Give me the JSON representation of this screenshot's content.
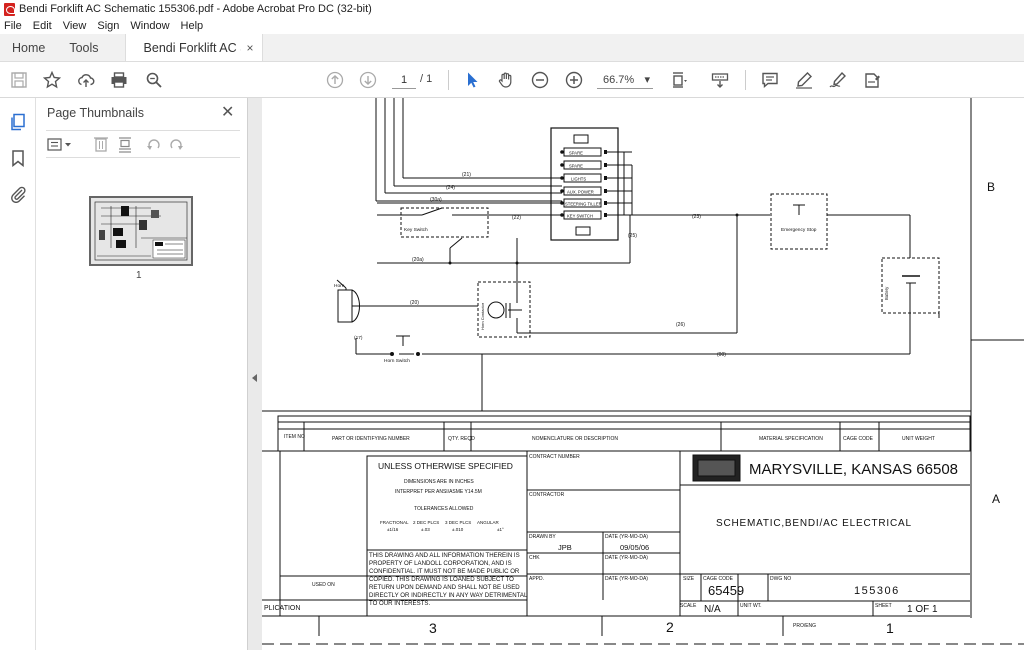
{
  "window": {
    "title": "Bendi Forklift AC Schematic 155306.pdf - Adobe Acrobat Pro DC (32-bit)"
  },
  "menu": [
    "File",
    "Edit",
    "View",
    "Sign",
    "Window",
    "Help"
  ],
  "tabs": {
    "home": "Home",
    "tools": "Tools",
    "document": "Bendi Forklift AC Sc...",
    "close": "×"
  },
  "toolbar": {
    "page_current": "1",
    "page_total": "/ 1",
    "zoom": "66.7%",
    "zoom_arrow": "▾"
  },
  "thumbnails": {
    "title": "Page Thumbnails",
    "close": "✕",
    "page_label": "1"
  },
  "schematic": {
    "switch_labels": [
      "SPARE",
      "SPARE",
      "LIGHTS",
      "AUX. POWER",
      "STEERING TILLER",
      "KEY SWITCH"
    ],
    "wire_labels": [
      "(21)",
      "(24)",
      "(30a)",
      "(20a)",
      "(20)",
      "(22)",
      "(23)",
      "(25)",
      "(26)",
      "(00)"
    ],
    "key_switch": "Key Switch",
    "emergency_stop": "Emergency Stop",
    "battery": "Battery",
    "horn": "Horn",
    "horn_switch": "Horn Switch",
    "horn_wire": "(17)",
    "horn_contactor": "Horn Contactor",
    "zone_b": "B",
    "zone_a": "A"
  },
  "title_block": {
    "col_item": "ITEM NO",
    "col_part": "PART OR IDENTIFYING NUMBER",
    "col_qty": "QTY. REQD",
    "col_desc": "NOMENCLATURE OR DESCRIPTION",
    "col_material": "MATERIAL SPECIFICATION",
    "col_cage": "CAGE CODE",
    "col_weight": "UNIT WEIGHT",
    "unless": "UNLESS OTHERWISE SPECIFIED",
    "dims": "DIMENSIONS ARE IN INCHES",
    "interpret": "INTERPRET PER ANSI/ASME Y14.5M",
    "tolerances": "TOLERANCES ALLOWED",
    "tol_fractional": "FRACTIONAL",
    "tol_2dec": "2 DEC PLCS",
    "tol_3dec": "3 DEC PLCS",
    "tol_angular": "ANGULAR",
    "tol_frac_val": "±1/16",
    "tol_2dec_val": "±.03",
    "tol_3dec_val": "±.010",
    "tol_ang_val": "±1°",
    "notice": [
      "THIS DRAWING AND ALL INFORMATION THEREIN IS",
      "PROPERTY OF LANDOLL CORPORATION, AND IS",
      "CONFIDENTIAL. IT MUST NOT BE MADE PUBLIC OR",
      "COPIED.  THIS DRAWING IS LOANED SUBJECT TO",
      "RETURN UPON DEMAND AND SHALL NOT BE USED",
      "DIRECTLY OR INDIRECTLY IN ANY WAY DETRIMENTAL",
      "TO OUR INTERESTS."
    ],
    "used_on": "USED ON",
    "application": "PLICATION",
    "contract_no": "CONTRACT NUMBER",
    "contractor": "CONTRACTOR",
    "drawn_by": "DRAWN BY",
    "drawn_by_val": "JPB",
    "date_label": "DATE (YR-MO-DA)",
    "date_val": "09/05/06",
    "chk": "CHK",
    "appd": "APPD.",
    "location": "MARYSVILLE, KANSAS  66508",
    "drawing_title": "SCHEMATIC,BENDI/AC ELECTRICAL",
    "size": "SIZE",
    "cage_code": "CAGE CODE",
    "cage_val": "65459",
    "dwg_no": "DWG NO",
    "dwg_val": "155306",
    "scale": "SCALE",
    "scale_val": "N/A",
    "unit_wt": "UNIT WT.",
    "sheet": "SHEET",
    "sheet_val": "1 OF 1",
    "pro_eng": "PRO/ENG",
    "zone_3": "3",
    "zone_2": "2",
    "zone_1": "1"
  }
}
